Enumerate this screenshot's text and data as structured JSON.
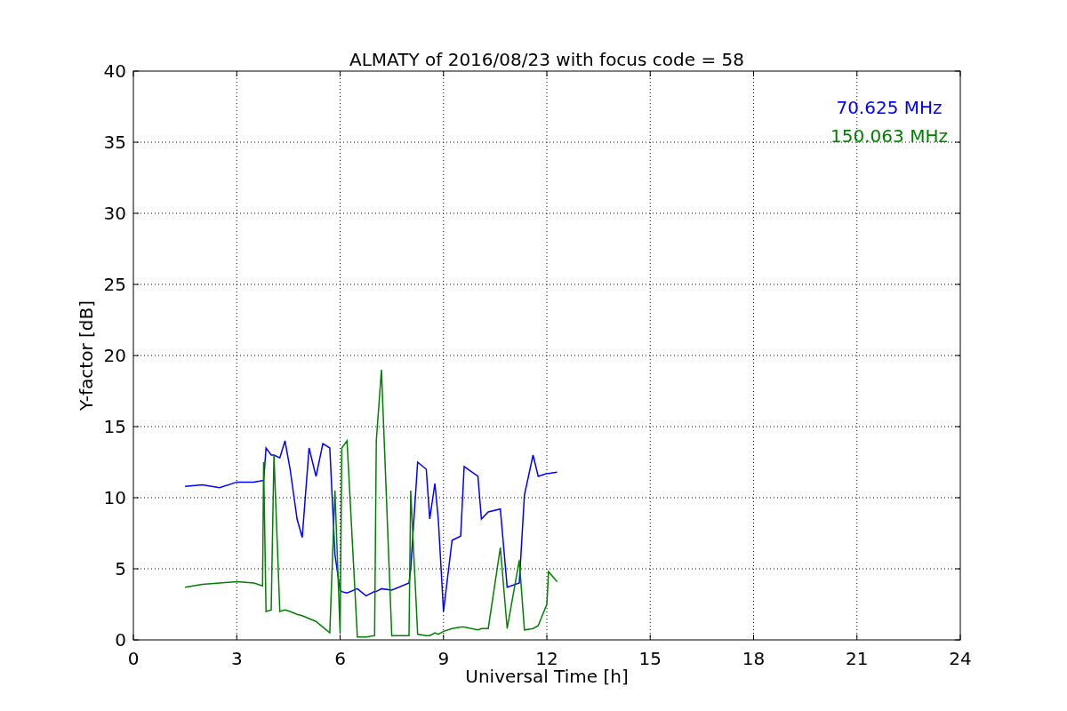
{
  "figure": {
    "chart_data": {
      "type": "line",
      "title": "ALMATY of 2016/08/23 with focus code = 58",
      "xlabel": "Universal Time [h]",
      "ylabel": "Y-factor [dB]",
      "x": [
        1.5,
        2,
        2.5,
        3,
        3.5,
        3.75,
        3.78,
        3.85,
        4,
        4.08,
        4.25,
        4.4,
        4.55,
        4.75,
        4.9,
        5.1,
        5.3,
        5.5,
        5.7,
        5.85,
        6,
        6.05,
        6.2,
        6.5,
        6.75,
        7,
        7.05,
        7.2,
        7.5,
        8,
        8.05,
        8.25,
        8.5,
        8.6,
        8.75,
        8.85,
        9,
        9.25,
        9.5,
        9.6,
        10,
        10.1,
        10.3,
        10.65,
        10.85,
        11.2,
        11.35,
        11.6,
        11.75,
        12,
        12.05,
        12.3
      ],
      "series": [
        {
          "name": "70.625 MHz",
          "color": "#0000ff",
          "values": [
            10.8,
            10.9,
            10.7,
            11.1,
            11.1,
            11.2,
            11.2,
            13.5,
            13,
            13,
            12.8,
            14,
            12,
            8.5,
            7.2,
            13.5,
            11.5,
            13.8,
            13.5,
            6,
            3.5,
            3.4,
            3.3,
            3.6,
            3.1,
            3.4,
            3.4,
            3.6,
            3.5,
            4,
            5,
            12.5,
            12,
            8.5,
            11,
            8.5,
            2,
            7,
            7.3,
            12.2,
            11.5,
            8.5,
            9,
            9.2,
            3.7,
            4,
            10.2,
            13,
            11.5,
            11.7,
            11.7,
            11.8
          ]
        },
        {
          "name": "150.063 MHz",
          "color": "#008000",
          "values": [
            3.7,
            3.9,
            4,
            4.1,
            4,
            3.8,
            12.5,
            2,
            2.1,
            13,
            2,
            2.1,
            2,
            1.8,
            1.7,
            1.5,
            1.3,
            0.9,
            0.5,
            10.5,
            0.5,
            13.5,
            14,
            0.2,
            0.2,
            0.3,
            14,
            19,
            0.3,
            0.3,
            10.5,
            0.4,
            0.3,
            0.3,
            0.5,
            0.4,
            0.6,
            0.8,
            0.9,
            0.9,
            0.7,
            0.8,
            0.8,
            6.5,
            0.8,
            5.6,
            0.7,
            0.8,
            1,
            2.5,
            4.8,
            4.1
          ]
        }
      ],
      "grid": true,
      "xlim": [
        0,
        24
      ],
      "ylim": [
        0,
        40
      ],
      "xticks": [
        0,
        3,
        6,
        9,
        12,
        15,
        18,
        21,
        24
      ],
      "yticks": [
        0,
        5,
        10,
        15,
        20,
        25,
        30,
        35,
        40
      ]
    }
  }
}
